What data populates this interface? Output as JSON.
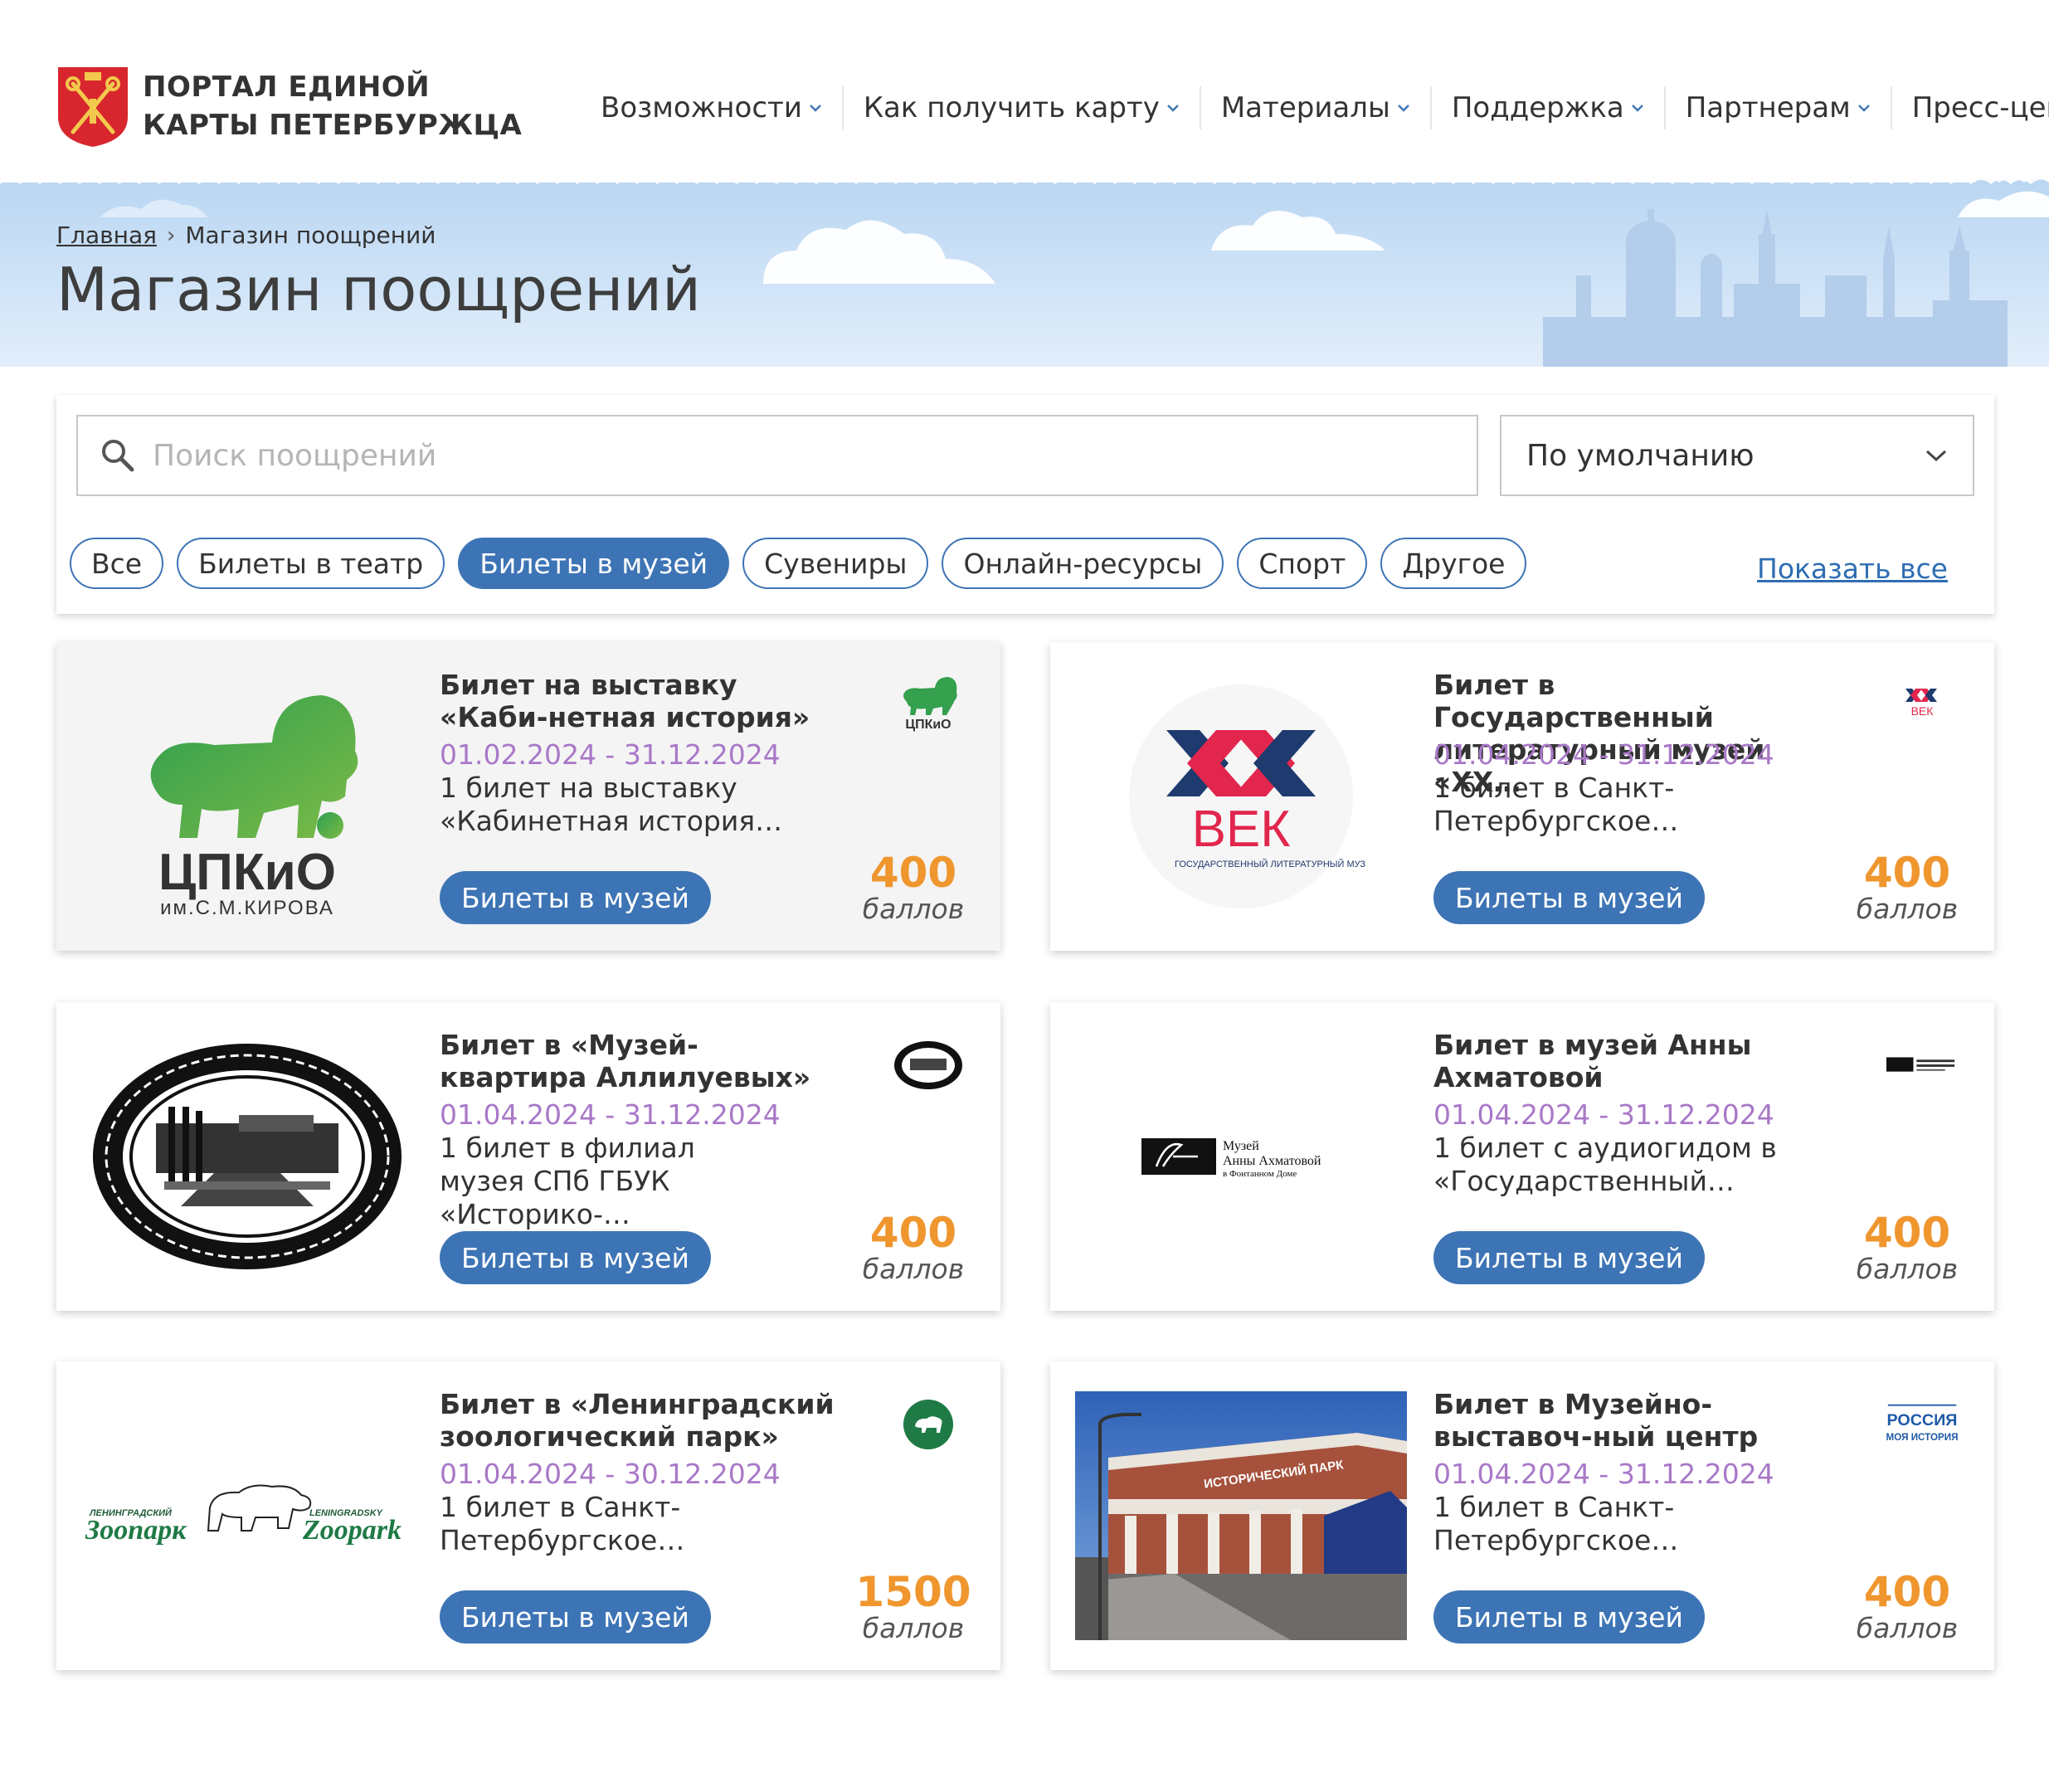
{
  "header": {
    "logo_line1": "ПОРТАЛ ЕДИНОЙ",
    "logo_line2": "КАРТЫ ПЕТЕРБУРЖЦА",
    "nav": [
      "Возможности",
      "Как получить карту",
      "Материалы",
      "Поддержка",
      "Партнерам",
      "Пресс-центр"
    ]
  },
  "breadcrumb": {
    "home": "Главная",
    "current": "Магазин поощрений"
  },
  "page_title": "Магазин поощрений",
  "search": {
    "placeholder": "Поиск поощрений",
    "value": ""
  },
  "sort": {
    "selected": "По умолчанию"
  },
  "filters": {
    "chips": [
      "Все",
      "Билеты в театр",
      "Билеты в музей",
      "Сувениры",
      "Онлайн-ресурсы",
      "Спорт",
      "Другое"
    ],
    "active": "Билеты в музей",
    "show_all": "Показать все"
  },
  "cards": [
    {
      "title": "Билет на выставку «Каби-нетная история»",
      "dates": "01.02.2024 - 31.12.2024",
      "desc": "1 билет на выставку «Кабинетная история…",
      "button": "Билеты в музей",
      "points": "400",
      "points_label": "баллов",
      "logo_text": "ЦПКиО",
      "logo_sub": "им.С.М.КИРОВА"
    },
    {
      "title": "Билет в Государственный литературный музей «XX…",
      "dates": "01.04.2024 - 31.12.2024",
      "desc": "1 билет в Санкт-Петербургское…",
      "button": "Билеты в музей",
      "points": "400",
      "points_label": "баллов",
      "logo_text": "ВЕК",
      "logo_sub": "ГОСУДАРСТВЕННЫЙ ЛИТЕРАТУРНЫЙ МУЗЕЙ"
    },
    {
      "title": "Билет в «Музей-квартира Аллилуевых»",
      "dates": "01.04.2024 - 31.12.2024",
      "desc": "1 билет в филиал музея СПб ГБУК «Историко-…",
      "button": "Билеты в музей",
      "points": "400",
      "points_label": "баллов"
    },
    {
      "title": "Билет в музей Анны Ахматовой",
      "dates": "01.04.2024 - 31.12.2024",
      "desc": "1 билет с аудиогидом в «Государственный…",
      "button": "Билеты в музей",
      "points": "400",
      "points_label": "баллов",
      "logo_line1": "Музей",
      "logo_line2": "Анны Ахматовой",
      "logo_line3": "в Фонтанном Доме"
    },
    {
      "title": "Билет в «Ленинградский зоологический парк»",
      "dates": "01.04.2024 - 30.12.2024",
      "desc": "1 билет в Санкт-Петербургское…",
      "button": "Билеты в музей",
      "points": "1500",
      "points_label": "баллов",
      "logo_left": "Зоопарк",
      "logo_right": "Zoopark",
      "logo_left_top": "ЛЕНИНГРАДСКИЙ",
      "logo_right_top": "LENINGRADSKY"
    },
    {
      "title": "Билет в Музейно-выставоч-ный центр",
      "dates": "01.04.2024 - 31.12.2024",
      "desc": "1 билет в Санкт-Петербургское…",
      "button": "Билеты в музей",
      "points": "400",
      "points_label": "баллов",
      "sign_text": "ИСТОРИЧЕСКИЙ ПАРК",
      "mini_line1": "РОССИЯ",
      "mini_line2": "МОЯ ИСТОРИЯ"
    }
  ],
  "colors": {
    "accent": "#3d74b5",
    "dates": "#a978c8",
    "points": "#f0962e",
    "cpkio_green": "#3a9a4a",
    "vek_red": "#e2264d",
    "vek_blue": "#1e3a6e"
  }
}
